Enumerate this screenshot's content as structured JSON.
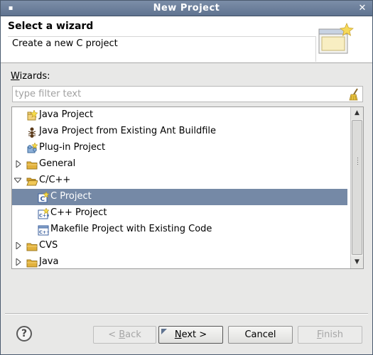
{
  "window": {
    "title": "New Project"
  },
  "titlebar": {
    "menu_glyph": "▪",
    "close_glyph": "✕"
  },
  "banner": {
    "heading": "Select a wizard",
    "message": "Create a new C project"
  },
  "wizards": {
    "label_mnemonic": "W",
    "label_rest": "izards:"
  },
  "filter": {
    "placeholder": "type filter text",
    "value": ""
  },
  "tree": {
    "items": [
      {
        "label": "Java Project",
        "icon": "java-project-icon",
        "level": 1,
        "expander": "none"
      },
      {
        "label": "Java Project from Existing Ant Buildfile",
        "icon": "ant-project-icon",
        "level": 1,
        "expander": "none"
      },
      {
        "label": "Plug-in Project",
        "icon": "plugin-project-icon",
        "level": 1,
        "expander": "none"
      },
      {
        "label": "General",
        "icon": "folder-icon",
        "level": 0,
        "expander": "collapsed"
      },
      {
        "label": "C/C++",
        "icon": "folder-open-icon",
        "level": 0,
        "expander": "expanded"
      },
      {
        "label": "C Project",
        "icon": "c-project-icon",
        "level": 1,
        "expander": "none",
        "selected": true
      },
      {
        "label": "C++ Project",
        "icon": "cpp-project-icon",
        "level": 1,
        "expander": "none"
      },
      {
        "label": "Makefile Project with Existing Code",
        "icon": "makefile-project-icon",
        "level": 1,
        "expander": "none"
      },
      {
        "label": "CVS",
        "icon": "folder-icon",
        "level": 0,
        "expander": "collapsed"
      },
      {
        "label": "Java",
        "icon": "folder-icon",
        "level": 0,
        "expander": "collapsed"
      }
    ],
    "selected_color": "#7589a6",
    "scroll_up_glyph": "▲",
    "scroll_down_glyph": "▼"
  },
  "buttons": {
    "help_glyph": "?",
    "back_prefix": "< ",
    "back_mnemonic": "B",
    "back_rest": "ack",
    "next_mnemonic": "N",
    "next_rest": "ext >",
    "cancel": "Cancel",
    "finish_mnemonic": "F",
    "finish_rest": "inish"
  },
  "colors": {
    "titlebar": "#5f7390",
    "dialog_bg": "#e8e8e7",
    "folder": "#e2b13c"
  }
}
